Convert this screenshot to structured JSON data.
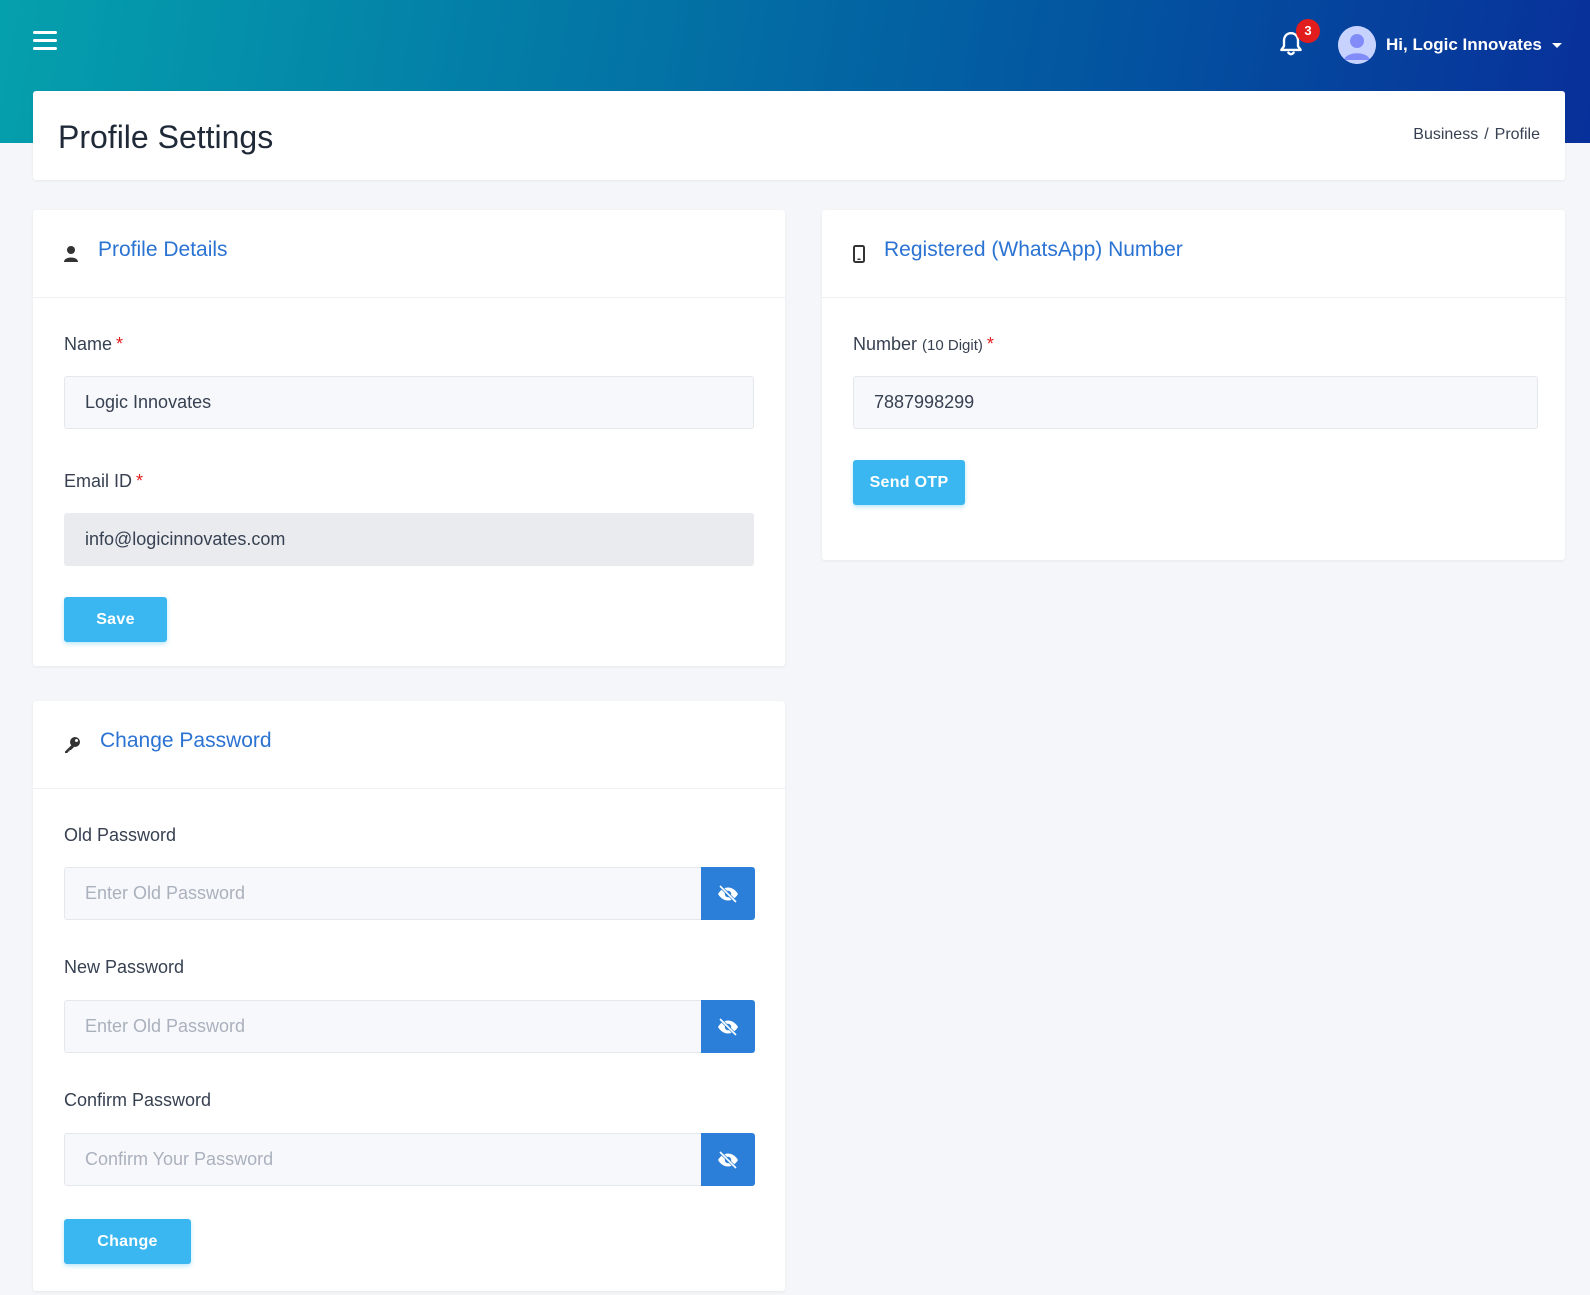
{
  "header": {
    "notification_count": "3",
    "user_greeting": "Hi, Logic Innovates"
  },
  "page": {
    "title": "Profile Settings",
    "breadcrumb": [
      "Business",
      "Profile"
    ]
  },
  "profile_details": {
    "title": "Profile Details",
    "name_label": "Name",
    "name_value": "Logic Innovates",
    "email_label": "Email ID",
    "email_value": "info@logicinnovates.com",
    "save_label": "Save"
  },
  "whatsapp": {
    "title": "Registered (WhatsApp) Number",
    "number_label": "Number",
    "number_hint": "(10 Digit)",
    "number_value": "7887998299",
    "send_otp_label": "Send OTP"
  },
  "change_password": {
    "title": "Change Password",
    "old_label": "Old Password",
    "old_placeholder": "Enter Old Password",
    "new_label": "New Password",
    "new_placeholder": "Enter Old Password",
    "confirm_label": "Confirm Password",
    "confirm_placeholder": "Confirm Your Password",
    "change_label": "Change"
  },
  "required_mark": "*",
  "icons": {
    "menu": "hamburger-icon",
    "notifications": "bell-icon",
    "user": "user-icon",
    "phone": "mobile-icon",
    "key": "key-icon",
    "toggle_visibility": "eye-slash-icon"
  },
  "colors": {
    "accent_blue": "#2b73d3",
    "button_cyan": "#3ab7f0",
    "eye_button": "#2b7fd8",
    "badge_red": "#e11d1d"
  }
}
